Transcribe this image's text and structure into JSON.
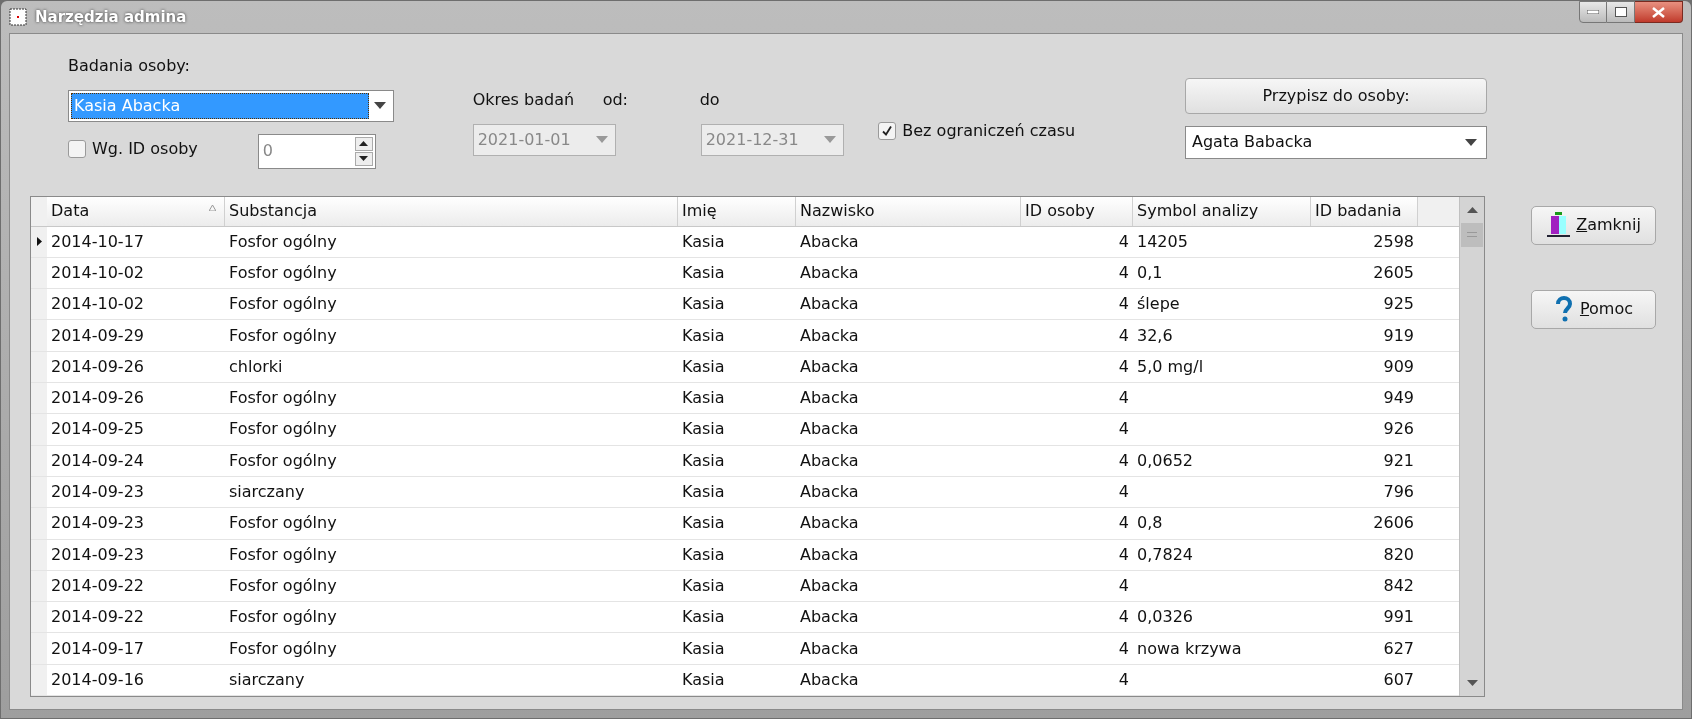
{
  "window": {
    "title": "Narzędzia admina"
  },
  "person": {
    "label": "Badania osoby:",
    "value": "Kasia Abacka"
  },
  "by_id": {
    "label": "Wg. ID osoby",
    "checked": false,
    "value": "0"
  },
  "period": {
    "label": "Okres badań",
    "from_label": "od:",
    "to_label": "do",
    "from": "2021-01-01",
    "to": "2021-12-31",
    "disabled": true
  },
  "no_limit": {
    "label": "Bez ograniczeń czasu",
    "checked": true
  },
  "assign": {
    "button": "Przypisz do osoby:",
    "value": "Agata Babacka"
  },
  "table": {
    "columns": [
      {
        "label": "Data",
        "sorted": true
      },
      {
        "label": "Substancja",
        "sorted": false
      },
      {
        "label": "Imię",
        "sorted": false
      },
      {
        "label": "Nazwisko",
        "sorted": false
      },
      {
        "label": "ID osoby",
        "sorted": false
      },
      {
        "label": "Symbol analizy",
        "sorted": false
      },
      {
        "label": "ID badania",
        "sorted": false
      }
    ],
    "rows": [
      {
        "current": true,
        "cells": [
          "2014-10-17",
          "Fosfor ogólny",
          "Kasia",
          "Abacka",
          "4",
          "14205",
          "2598"
        ]
      },
      {
        "current": false,
        "cells": [
          "2014-10-02",
          "Fosfor ogólny",
          "Kasia",
          "Abacka",
          "4",
          "0,1",
          "2605"
        ]
      },
      {
        "current": false,
        "cells": [
          "2014-10-02",
          "Fosfor ogólny",
          "Kasia",
          "Abacka",
          "4",
          "ślepe",
          "925"
        ]
      },
      {
        "current": false,
        "cells": [
          "2014-09-29",
          "Fosfor ogólny",
          "Kasia",
          "Abacka",
          "4",
          "32,6",
          "919"
        ]
      },
      {
        "current": false,
        "cells": [
          "2014-09-26",
          "chlorki",
          "Kasia",
          "Abacka",
          "4",
          "5,0 mg/l",
          "909"
        ]
      },
      {
        "current": false,
        "cells": [
          "2014-09-26",
          "Fosfor ogólny",
          "Kasia",
          "Abacka",
          "4",
          "",
          "949"
        ]
      },
      {
        "current": false,
        "cells": [
          "2014-09-25",
          "Fosfor ogólny",
          "Kasia",
          "Abacka",
          "4",
          "",
          "926"
        ]
      },
      {
        "current": false,
        "cells": [
          "2014-09-24",
          "Fosfor ogólny",
          "Kasia",
          "Abacka",
          "4",
          "0,0652",
          "921"
        ]
      },
      {
        "current": false,
        "cells": [
          "2014-09-23",
          "siarczany",
          "Kasia",
          "Abacka",
          "4",
          "",
          "796"
        ]
      },
      {
        "current": false,
        "cells": [
          "2014-09-23",
          "Fosfor ogólny",
          "Kasia",
          "Abacka",
          "4",
          "0,8",
          "2606"
        ]
      },
      {
        "current": false,
        "cells": [
          "2014-09-23",
          "Fosfor ogólny",
          "Kasia",
          "Abacka",
          "4",
          "0,7824",
          "820"
        ]
      },
      {
        "current": false,
        "cells": [
          "2014-09-22",
          "Fosfor ogólny",
          "Kasia",
          "Abacka",
          "4",
          "",
          "842"
        ]
      },
      {
        "current": false,
        "cells": [
          "2014-09-22",
          "Fosfor ogólny",
          "Kasia",
          "Abacka",
          "4",
          "0,0326",
          "991"
        ]
      },
      {
        "current": false,
        "cells": [
          "2014-09-17",
          "Fosfor ogólny",
          "Kasia",
          "Abacka",
          "4",
          "nowa krzywa",
          "627"
        ]
      },
      {
        "current": false,
        "cells": [
          "2014-09-16",
          "siarczany",
          "Kasia",
          "Abacka",
          "4",
          "",
          "607"
        ]
      }
    ]
  },
  "buttons": [
    {
      "kind": "close",
      "label": "Zamknij"
    },
    {
      "kind": "help",
      "label": "Pomoc"
    }
  ]
}
